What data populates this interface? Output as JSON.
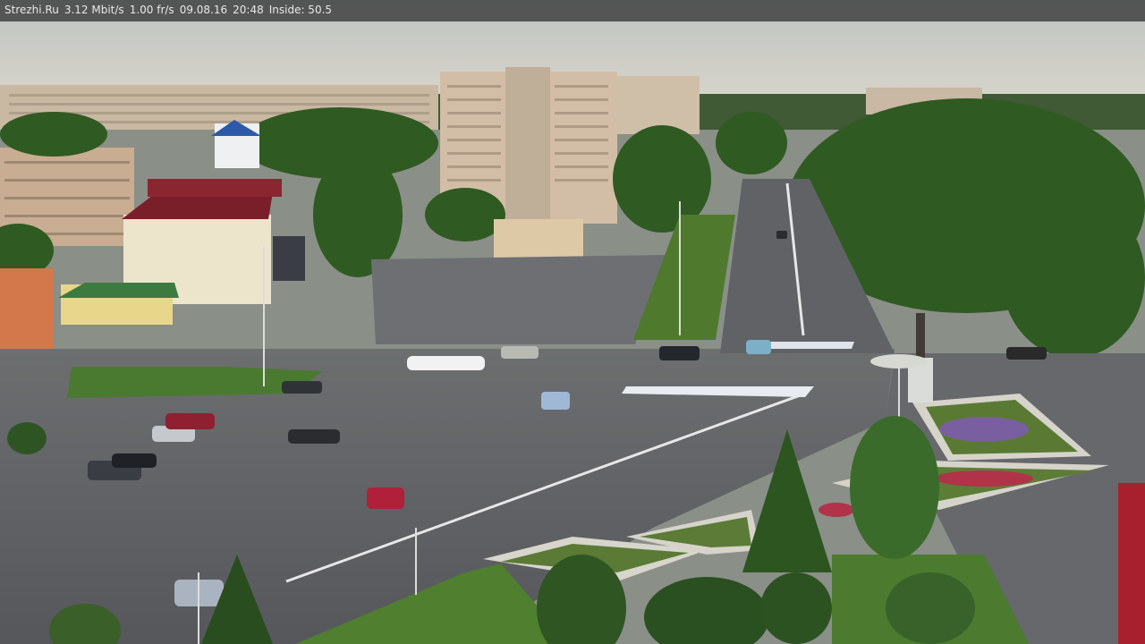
{
  "overlay": {
    "site": "Strezhi.Ru",
    "bitrate": "3.12 Mbit/s",
    "framerate": "1.00 fr/s",
    "date": "09.08.16",
    "time": "20:48",
    "inside": "Inside: 50.5"
  },
  "scene": {
    "sky_color": "#c9ccc6",
    "road_color": "#5f6166",
    "grass_color": "#4f7a2e",
    "tree_color": "#2f5a22",
    "building_color": "#c7b39a",
    "accent_red": "#8a1f2a"
  }
}
